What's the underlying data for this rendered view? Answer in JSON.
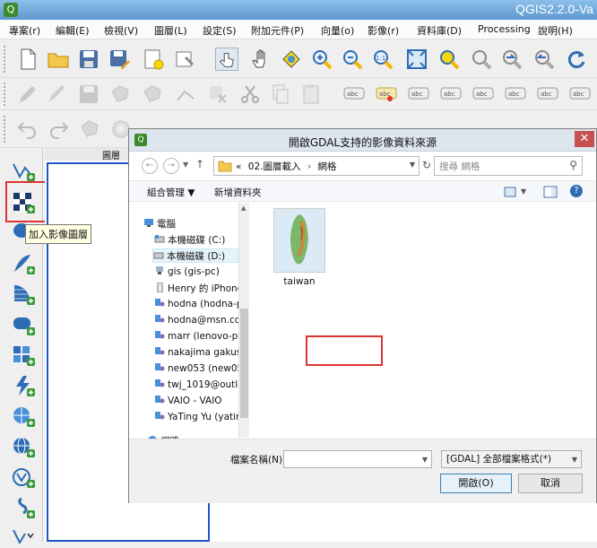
{
  "app": {
    "title": "QGIS2.2.0-Va",
    "logo": "qgis-logo"
  },
  "menu": [
    "專案(r)",
    "編輯(E)",
    "檢視(V)",
    "圖層(L)",
    "設定(S)",
    "附加元件(P)",
    "向量(o)",
    "影像(r)",
    "資料庫(D)",
    "Processing",
    "說明(H)"
  ],
  "toolbars": {
    "row1": [
      "new-project-icon",
      "open-project-icon",
      "save-project-icon",
      "save-as-icon",
      "new-print-composer-icon",
      "composer-manager-icon",
      "touch-icon",
      "pan-icon",
      "pan-to-selection-icon",
      "zoom-in-icon",
      "zoom-out-icon",
      "zoom-actual-icon",
      "zoom-full-icon",
      "zoom-to-selection-icon",
      "zoom-to-layer-icon",
      "zoom-last-icon",
      "zoom-next-icon",
      "refresh-icon"
    ],
    "row2": [
      "toggle-editing-icon",
      "edit-pencil-icon",
      "save-edits-icon",
      "add-feature-icon",
      "move-feature-icon",
      "node-tool-icon",
      "delete-selected-icon",
      "cut-icon",
      "copy-icon",
      "paste-icon",
      "label-icon",
      "label-pin-icon",
      "label-show-icon",
      "label-move-icon",
      "label-rotate-icon",
      "label-change-icon"
    ],
    "row3": [
      "undo-icon",
      "redo-icon",
      "simplify-icon",
      "add-ring-icon"
    ]
  },
  "leftbar_icons": [
    "add-vector-layer-icon",
    "add-raster-layer-icon",
    "add-postgis-layer-icon",
    "add-spatialite-layer-icon",
    "add-mssql-layer-icon",
    "add-delimited-text-icon",
    "add-oracle-layer-icon",
    "add-wms-layer-icon",
    "add-wcs-layer-icon",
    "add-wfs-layer-icon",
    "new-shapefile-icon",
    "new-spatialite-icon",
    "add-gps-icon"
  ],
  "tooltip": "加入影像圖層",
  "layer_panel_title": "圖層",
  "dialog": {
    "title": "開啟GDAL支持的影像資料來源",
    "breadcrumb": "« 02.圖層載入 › 網格",
    "breadcrumb_prefix": "«",
    "breadcrumb_part1": "02.圖層載入",
    "breadcrumb_part2": "網格",
    "search_placeholder": "搜尋 網格",
    "organize": "組合管理 ▼",
    "new_folder": "新增資料夾",
    "tree": [
      {
        "label": "電腦",
        "icon": "computer-icon",
        "indent": 0
      },
      {
        "label": "本機磁碟 (C:)",
        "icon": "drive-icon",
        "indent": 1
      },
      {
        "label": "本機磁碟 (D:)",
        "icon": "drive-icon",
        "indent": 1,
        "selected": true
      },
      {
        "label": "gis (gis-pc)",
        "icon": "network-pc-icon",
        "indent": 1
      },
      {
        "label": "Henry 的 iPhone",
        "icon": "phone-icon",
        "indent": 1
      },
      {
        "label": "hodna (hodna-p",
        "icon": "homegroup-icon",
        "indent": 1
      },
      {
        "label": "hodna@msn.co",
        "icon": "homegroup-icon",
        "indent": 1
      },
      {
        "label": "marr (lenovo-pc",
        "icon": "homegroup-icon",
        "indent": 1
      },
      {
        "label": "nakajima gakusl",
        "icon": "homegroup-icon",
        "indent": 1
      },
      {
        "label": "new053 (new05",
        "icon": "homegroup-icon",
        "indent": 1
      },
      {
        "label": "twj_1019@outlc",
        "icon": "homegroup-icon",
        "indent": 1
      },
      {
        "label": "VAIO - VAIO",
        "icon": "homegroup-icon",
        "indent": 1
      },
      {
        "label": "YaTing Yu (yatin",
        "icon": "homegroup-icon",
        "indent": 1
      },
      {
        "label": "網路",
        "icon": "network-icon",
        "indent": 0
      }
    ],
    "file": {
      "name": "taiwan",
      "icon": "taiwan-map-thumbnail"
    },
    "filename_label": "檔案名稱(N):",
    "filename_value": "",
    "filetype_value": "[GDAL] 全部檔案格式(*)",
    "open_button": "開啟(O)",
    "cancel_button": "取消"
  },
  "colors": {
    "highlight": "#dd3333",
    "titlebar": "#5c98cf",
    "selection_border": "#1c57c6"
  }
}
